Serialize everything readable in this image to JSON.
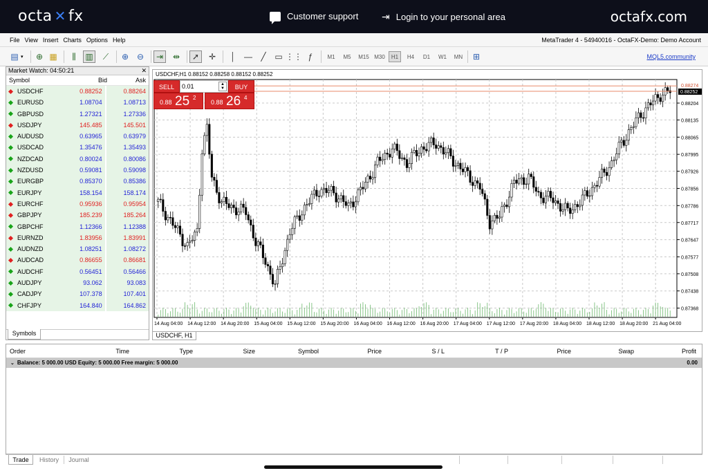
{
  "brand": {
    "logo_left_a": "octa",
    "logo_left_b": "fx",
    "support": "Customer support",
    "login": "Login to your personal area",
    "logo_right": "octafx.com"
  },
  "menu": {
    "items": [
      "File",
      "View",
      "Insert",
      "Charts",
      "Options",
      "Help"
    ],
    "title": "MetaTrader 4 - 54940016 - OctaFX-Demo: Demo Account"
  },
  "toolbar": {
    "timeframes": [
      "M1",
      "M5",
      "M15",
      "M30",
      "H1",
      "H4",
      "D1",
      "W1",
      "MN"
    ],
    "active_timeframe": "H1",
    "mql_link": "MQL5.community"
  },
  "market_watch": {
    "title": "Market Watch: 04:50:21",
    "col_symbol": "Symbol",
    "col_bid": "Bid",
    "col_ask": "Ask",
    "tab": "Symbols",
    "rows": [
      {
        "symbol": "USDCHF",
        "bid": "0.88252",
        "ask": "0.88264",
        "dir": "down"
      },
      {
        "symbol": "EURUSD",
        "bid": "1.08704",
        "ask": "1.08713",
        "dir": "up"
      },
      {
        "symbol": "GBPUSD",
        "bid": "1.27321",
        "ask": "1.27336",
        "dir": "up"
      },
      {
        "symbol": "USDJPY",
        "bid": "145.485",
        "ask": "145.501",
        "dir": "down"
      },
      {
        "symbol": "AUDUSD",
        "bid": "0.63965",
        "ask": "0.63979",
        "dir": "up"
      },
      {
        "symbol": "USDCAD",
        "bid": "1.35476",
        "ask": "1.35493",
        "dir": "up"
      },
      {
        "symbol": "NZDCAD",
        "bid": "0.80024",
        "ask": "0.80086",
        "dir": "up"
      },
      {
        "symbol": "NZDUSD",
        "bid": "0.59081",
        "ask": "0.59098",
        "dir": "up"
      },
      {
        "symbol": "EURGBP",
        "bid": "0.85370",
        "ask": "0.85386",
        "dir": "up"
      },
      {
        "symbol": "EURJPY",
        "bid": "158.154",
        "ask": "158.174",
        "dir": "up"
      },
      {
        "symbol": "EURCHF",
        "bid": "0.95936",
        "ask": "0.95954",
        "dir": "down"
      },
      {
        "symbol": "GBPJPY",
        "bid": "185.239",
        "ask": "185.264",
        "dir": "down"
      },
      {
        "symbol": "GBPCHF",
        "bid": "1.12366",
        "ask": "1.12388",
        "dir": "up"
      },
      {
        "symbol": "EURNZD",
        "bid": "1.83956",
        "ask": "1.83991",
        "dir": "down"
      },
      {
        "symbol": "AUDNZD",
        "bid": "1.08251",
        "ask": "1.08272",
        "dir": "up"
      },
      {
        "symbol": "AUDCAD",
        "bid": "0.86655",
        "ask": "0.86681",
        "dir": "down"
      },
      {
        "symbol": "AUDCHF",
        "bid": "0.56451",
        "ask": "0.56466",
        "dir": "up"
      },
      {
        "symbol": "AUDJPY",
        "bid": "93.062",
        "ask": "93.083",
        "dir": "up"
      },
      {
        "symbol": "CADJPY",
        "bid": "107.378",
        "ask": "107.401",
        "dir": "up"
      },
      {
        "symbol": "CHFJPY",
        "bid": "164.840",
        "ask": "164.862",
        "dir": "up"
      }
    ]
  },
  "chart": {
    "title": "USDCHF,H1  0.88152 0.88258 0.88152 0.88252",
    "tab": "USDCHF, H1",
    "sell_label": "SELL",
    "buy_label": "BUY",
    "lot": "0.01",
    "sell_small": "0.88",
    "sell_big": "25",
    "sell_sup": "2",
    "buy_small": "0.88",
    "buy_big": "26",
    "buy_sup": "4",
    "current_price": "0.88252",
    "top_price": "0.88274",
    "price_labels": [
      "0.88204",
      "0.88135",
      "0.88065",
      "0.87995",
      "0.87926",
      "0.87856",
      "0.87786",
      "0.87717",
      "0.87647",
      "0.87577",
      "0.87508",
      "0.87438",
      "0.87368"
    ],
    "time_labels": [
      "14 Aug 04:00",
      "14 Aug 12:00",
      "14 Aug 20:00",
      "15 Aug 04:00",
      "15 Aug 12:00",
      "15 Aug 20:00",
      "16 Aug 04:00",
      "16 Aug 12:00",
      "16 Aug 20:00",
      "17 Aug 04:00",
      "17 Aug 12:00",
      "17 Aug 20:00",
      "18 Aug 04:00",
      "18 Aug 12:00",
      "18 Aug 20:00",
      "21 Aug 04:00"
    ]
  },
  "terminal": {
    "columns": [
      "Order",
      "Time",
      "Type",
      "Size",
      "Symbol",
      "Price",
      "S / L",
      "T / P",
      "Price",
      "Swap",
      "Profit"
    ],
    "balance_line": "Balance: 5 000.00 USD  Equity: 5 000.00  Free margin: 5 000.00",
    "profit": "0.00",
    "tabs": [
      "Trade",
      "History",
      "Journal"
    ]
  }
}
